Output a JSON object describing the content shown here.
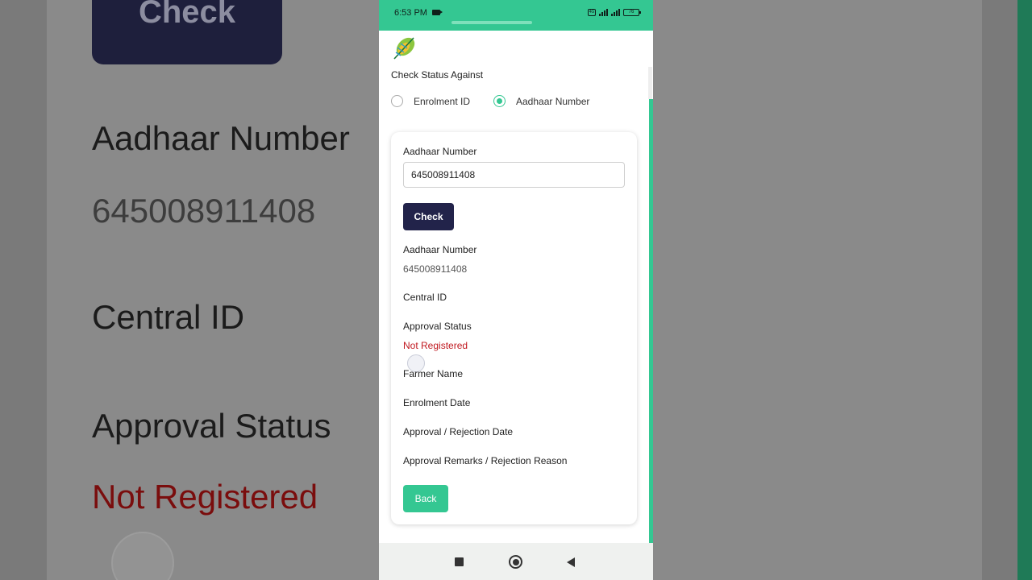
{
  "status_bar": {
    "time": "6:53 PM",
    "network_badge": "4G",
    "battery": "76"
  },
  "page": {
    "section_title": "Check Status Against",
    "radio_options": [
      {
        "label": "Enrolment ID",
        "selected": false
      },
      {
        "label": "Aadhaar Number",
        "selected": true
      }
    ]
  },
  "form": {
    "input_label": "Aadhaar Number",
    "input_value": "645008911408",
    "check_label": "Check"
  },
  "result": {
    "aadhaar_label": "Aadhaar Number",
    "aadhaar_value": "645008911408",
    "central_id_label": "Central ID",
    "approval_status_label": "Approval Status",
    "approval_status_value": "Not Registered",
    "farmer_name_label": "Farmer Name",
    "enrolment_date_label": "Enrolment Date",
    "approval_date_label": "Approval / Rejection Date",
    "remarks_label": "Approval Remarks / Rejection Reason"
  },
  "back_label": "Back",
  "colors": {
    "accent": "#34c792",
    "primary_button": "#22234a",
    "error": "#c0181f"
  },
  "icons": {
    "logo": "leaf-logo-icon",
    "nav_recent": "square-icon",
    "nav_home": "circle-icon",
    "nav_back": "triangle-back-icon"
  }
}
